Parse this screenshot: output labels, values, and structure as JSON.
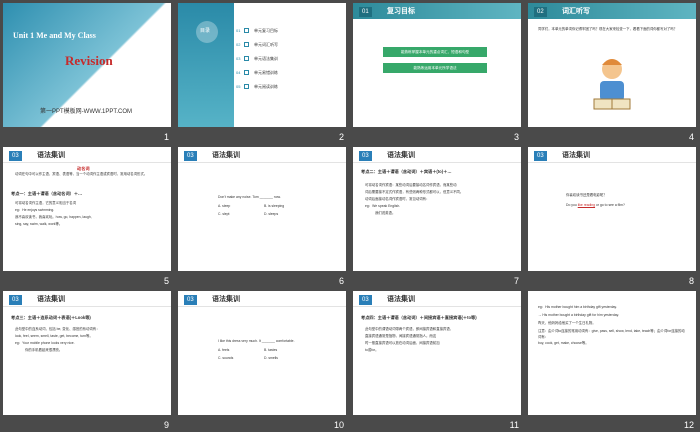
{
  "slides": [
    {
      "number": "1",
      "title": "Unit 1 Me and My Class",
      "subtitle": "Revision",
      "footer": "第一PPT模板网-WWW.1PPT.COM"
    },
    {
      "number": "2",
      "badge": "目录",
      "items": [
        "单元复习目标",
        "单元词汇听写",
        "单元语法集训",
        "单元易错训练",
        "单元阅读训练"
      ],
      "codes": [
        "01",
        "02",
        "03",
        "04",
        "05"
      ]
    },
    {
      "number": "3",
      "tag": "01",
      "header": "复习目标",
      "goals": [
        "能熟练掌握本单元的重点词汇、短语和句型",
        "能熟练运用本单元所学语法"
      ]
    },
    {
      "number": "4",
      "tag": "02",
      "header": "词汇听写",
      "text": "同学们，本单元的单词你记得牢固了吗？现在大家来检查一下，看看下面的词你都写对了吗？"
    },
    {
      "number": "5",
      "tag": "03",
      "header": "语法集训",
      "red_title": "动名词",
      "intro": "动词在句中可以作主语、宾语、表语等，当一个动词作主语或宾语时，常用动名词形式。",
      "point_label": "考点一：",
      "point_text": "主语＋谓语（含动名词）＋…",
      "lines": [
        "可将动名词作主语，它的意义相当于名词",
        "eg：He enjoys swimming.",
        "我不喜欢读书，我喜欢玩。how, go, happen, laugh,",
        "sing, say, swim, walk, work等。"
      ]
    },
    {
      "number": "6",
      "tag": "03",
      "header": "语法集训",
      "question": "Don't make any noise. Tom _______ now.",
      "options": [
        "A. sleep",
        "B. is sleeping",
        "C. slept",
        "D. sleeps"
      ]
    },
    {
      "number": "7",
      "tag": "03",
      "header": "语法集训",
      "point_label": "考点二：",
      "point_text": "主语＋谓语（含动词）＋宾语＋(to)＋…",
      "lines": [
        "可将动名词作宾语：某些动词后要接动名词作宾语，而某些动",
        "词后需要接不定式作宾语，有些则两种形式都可以，但意义不同。",
        "动词后面接动名词作宾语时，常见动词有：",
        "eg：We speak English.",
        "我们说英语。"
      ]
    },
    {
      "number": "8",
      "tag": "03",
      "header": "语法集训",
      "question": "你喜欢读书还是看电影呢？",
      "answer_prefix": "Do you",
      "answer_fill": "like reading",
      "answer_suffix": "or go to see a film?"
    },
    {
      "number": "9",
      "tag": "03",
      "header": "语法集训",
      "point_label": "考点三：",
      "point_text": "主语＋连系动词＋表语(＋Look等)",
      "lines": [
        "此句型中的连系动词，包括 be, 变化、感官的系动词有：",
        "look, feel, seem, smell, taste, get, become, turn等。",
        "eg：Your mobile phone looks very nice.",
        "你的手机看起来很漂亮。"
      ]
    },
    {
      "number": "10",
      "tag": "03",
      "header": "语法集训",
      "question": "I like this dress very much. It _______ comfortable.",
      "options": [
        "A. feels",
        "B. tastes",
        "C. sounds",
        "D. smells"
      ]
    },
    {
      "number": "11",
      "tag": "03",
      "header": "语法集训",
      "point_label": "考点四：",
      "point_text": "主语＋谓语（含动词）＋间接宾语＋直接宾语(＋to等)",
      "lines": [
        "此句型中的谓语动词带两个宾语，即间接宾语和直接宾语，",
        "直接宾语通常是指物，间接宾语通常指人。而这",
        "时一般直接宾语可以放在动词后面，间接宾语前加",
        "to或for。"
      ]
    },
    {
      "number": "12",
      "tag": "03",
      "header": "语法集训",
      "lines": [
        "eg：His mother bought him a birthday gift yesterday.",
        "→ His mother bought a birthday gift for him yesterday.",
        "昨天，他妈妈给他买了一个生日礼物。",
        "注意：由介词to连接的常用动词有：give, pass, sell, show, lend, take, teach等；由介词for连接的动词有：",
        "buy, cook, get, make, choose等。"
      ]
    }
  ],
  "colors": {
    "teal": "#2d8a9a",
    "red": "#c62b2b",
    "blue_tag": "#2a7fb8",
    "green_box": "#37a86a"
  }
}
